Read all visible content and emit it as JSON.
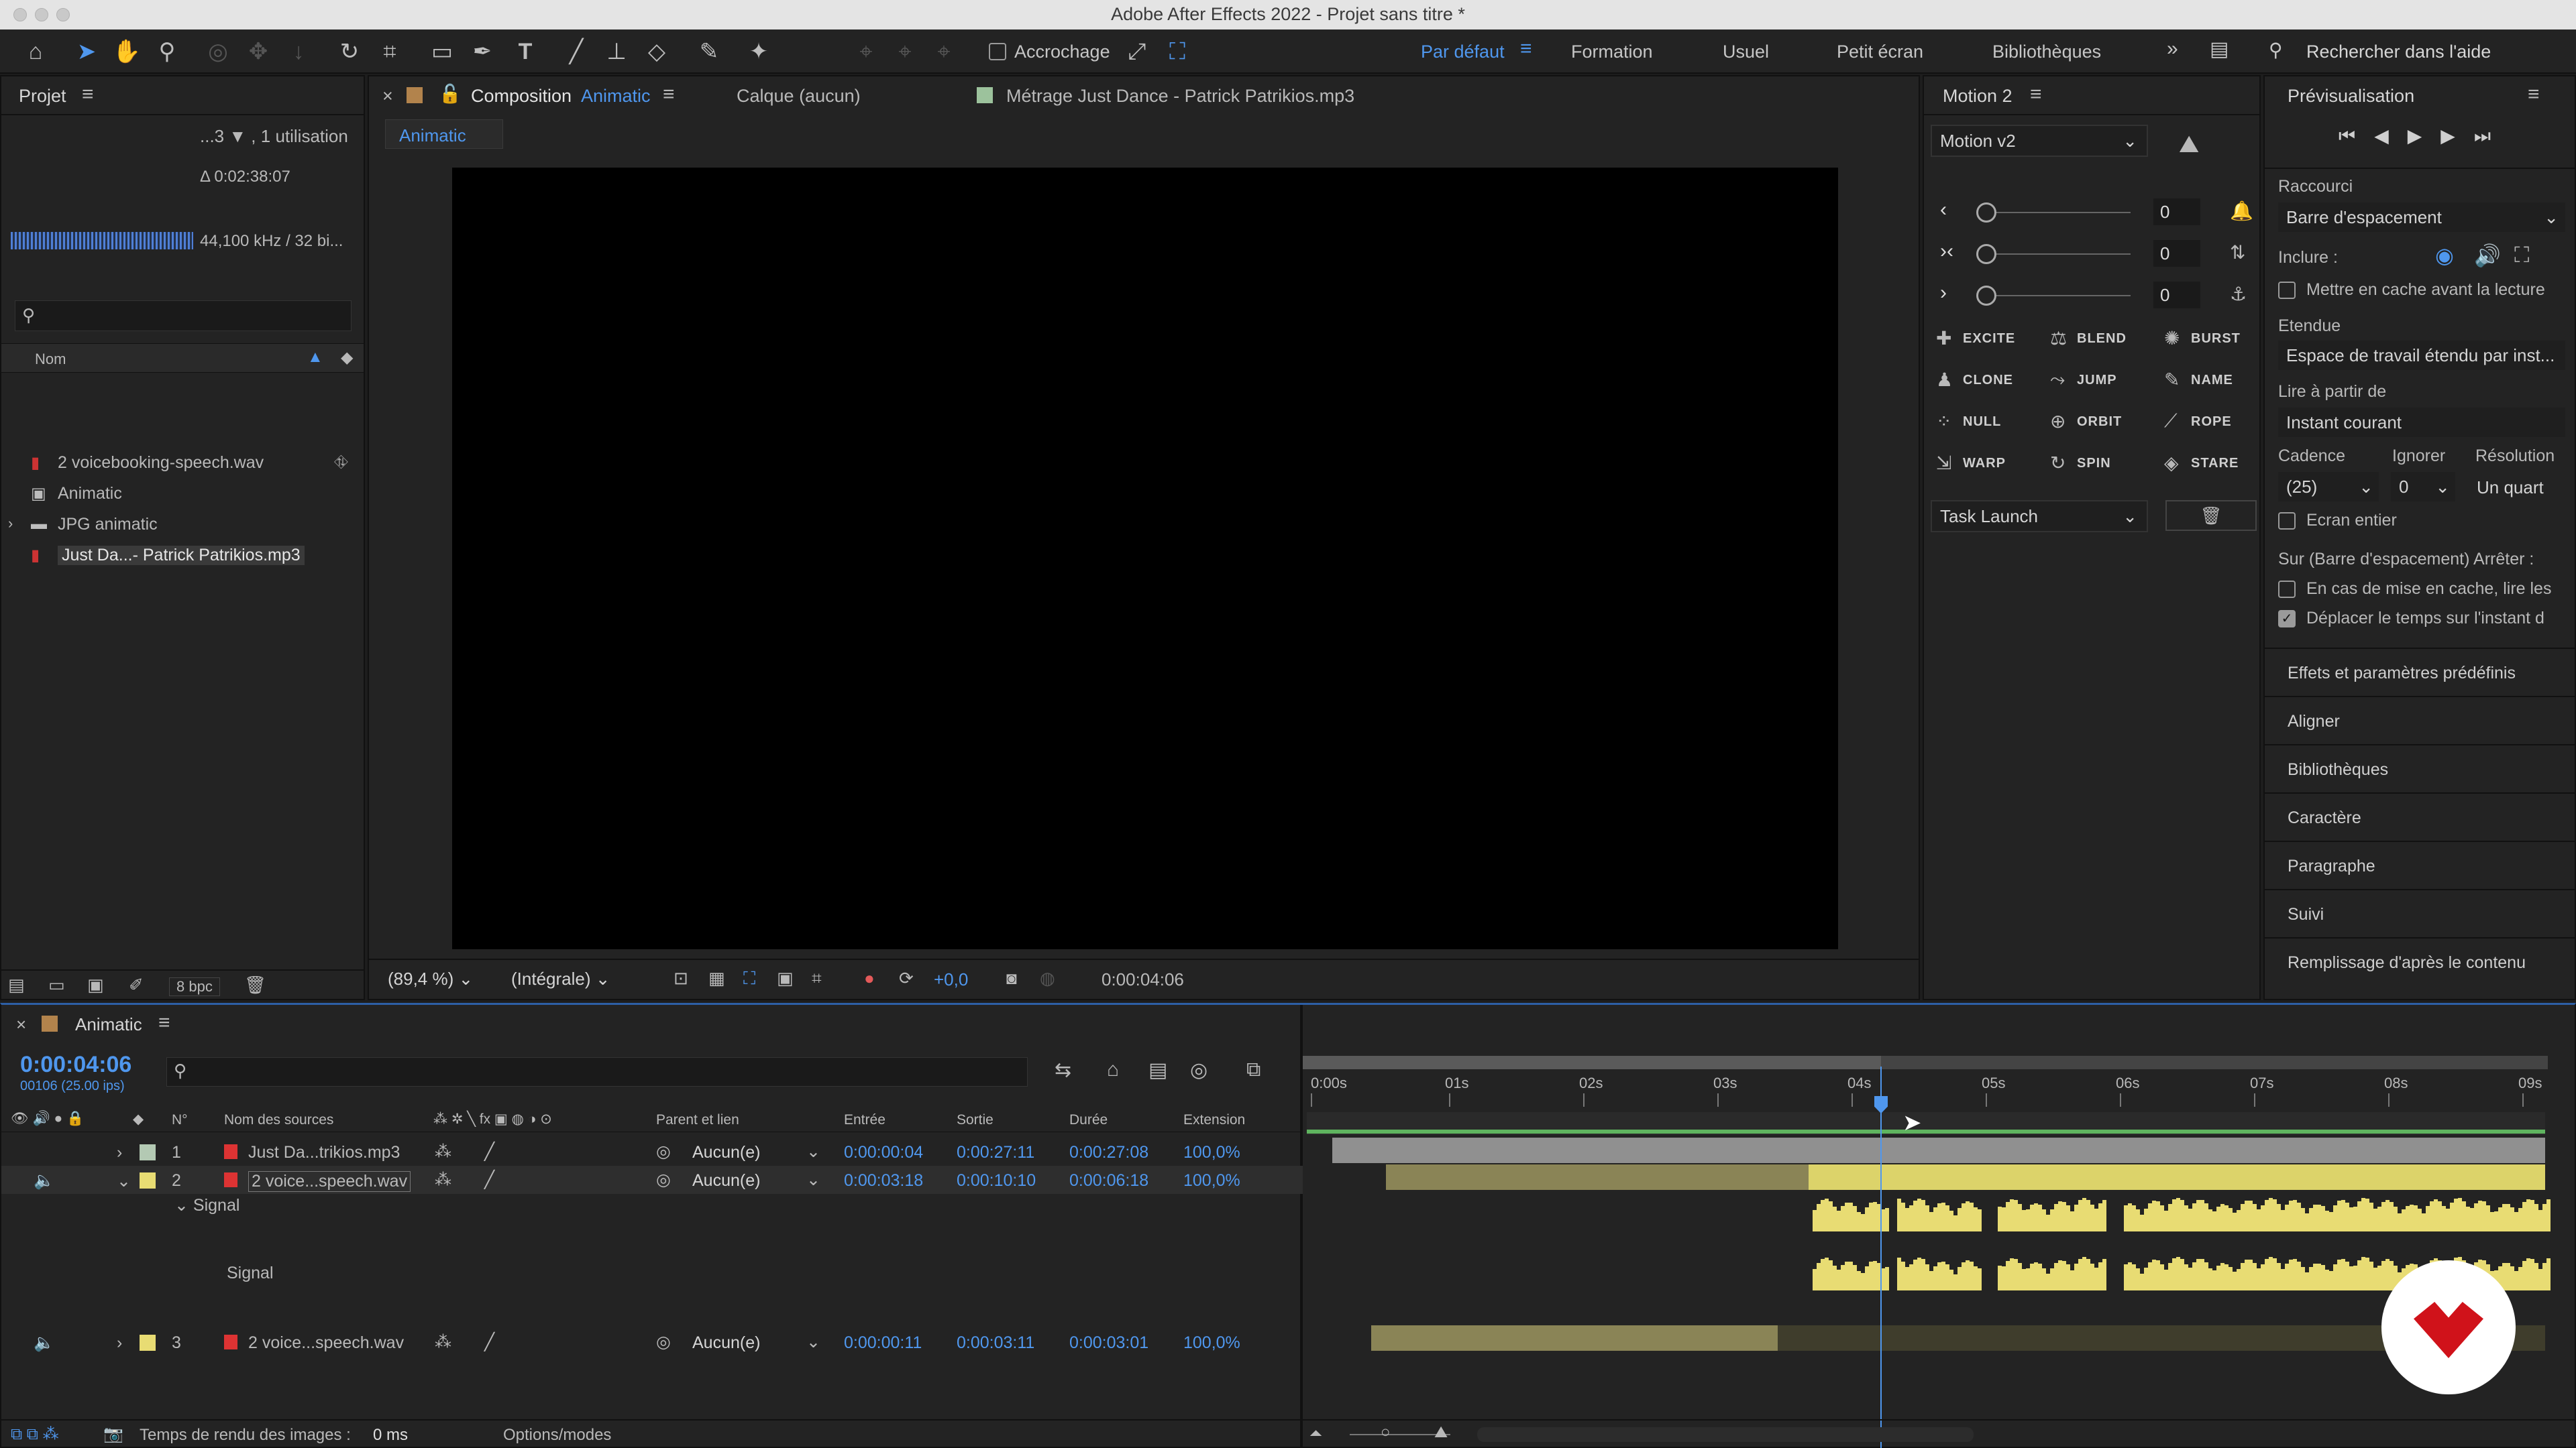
{
  "window": {
    "title": "Adobe After Effects 2022 - Projet sans titre *"
  },
  "toolbar": {
    "snap_label": "Accrochage",
    "workspaces": [
      "Par défaut",
      "Formation",
      "Usuel",
      "Petit écran",
      "Bibliothèques"
    ],
    "search_placeholder": "Rechercher dans l'aide"
  },
  "project": {
    "title": "Projet",
    "usage": "...3 ▼ , 1 utilisation",
    "duration": "Δ 0:02:38:07",
    "audio_info": "44,100 kHz / 32 bi...",
    "col_name": "Nom",
    "items": [
      {
        "name": "2 voicebooking-speech.wav",
        "icon": "audio-file-icon"
      },
      {
        "name": "Animatic",
        "icon": "composition-icon"
      },
      {
        "name": "JPG animatic",
        "icon": "folder-icon"
      },
      {
        "name": "Just Da...- Patrick Patrikios.mp3",
        "icon": "audio-file-icon"
      }
    ],
    "bpc": "8 bpc"
  },
  "composition": {
    "tab_prefix": "Composition",
    "tab_name": "Animatic",
    "layer_label": "Calque  (aucun)",
    "footage_label": "Métrage  Just Dance - Patrick Patrikios.mp3",
    "subtab": "Animatic",
    "zoom": "(89,4 %)",
    "resolution": "(Intégrale)",
    "exposure": "+0,0",
    "timecode": "0:00:04:06"
  },
  "motion": {
    "title": "Motion 2",
    "preset": "Motion v2",
    "sliders": [
      "0",
      "0",
      "0"
    ],
    "buttons": [
      "EXCITE",
      "BLEND",
      "BURST",
      "CLONE",
      "JUMP",
      "NAME",
      "NULL",
      "ORBIT",
      "ROPE",
      "WARP",
      "SPIN",
      "STARE"
    ],
    "task": "Task Launch"
  },
  "preview": {
    "title": "Prévisualisation",
    "shortcut_label": "Raccourci",
    "shortcut_value": "Barre d'espacement",
    "include_label": "Inclure :",
    "cache_label": "Mettre en cache avant la lecture",
    "range_label": "Etendue",
    "range_value": "Espace de travail étendu par inst...",
    "play_from_label": "Lire à partir de",
    "play_from_value": "Instant courant",
    "cadence_label": "Cadence",
    "skip_label": "Ignorer",
    "resolution_label": "Résolution",
    "cadence_value": "(25)",
    "skip_value": "0",
    "resolution_value": "Un quart",
    "fullscreen_label": "Ecran entier",
    "stop_label": "Sur (Barre d'espacement) Arrêter :",
    "cached_label": "En cas de mise en cache, lire les",
    "move_time_label": "Déplacer le temps sur l'instant d",
    "sections": [
      "Effets et paramètres prédéfinis",
      "Aligner",
      "Bibliothèques",
      "Caractère",
      "Paragraphe",
      "Suivi",
      "Remplissage d'après le contenu"
    ]
  },
  "timeline": {
    "tab": "Animatic",
    "timecode": "0:00:04:06",
    "frames": "00106 (25.00 ips)",
    "columns": {
      "num": "N°",
      "source": "Nom des sources",
      "parent": "Parent et lien",
      "in": "Entrée",
      "out": "Sortie",
      "duration": "Durée",
      "stretch": "Extension"
    },
    "ruler": [
      "0:00s",
      "01s",
      "02s",
      "03s",
      "04s",
      "05s",
      "06s",
      "07s",
      "08s",
      "09s"
    ],
    "layers": [
      {
        "num": "1",
        "name": "Just Da...trikios.mp3",
        "parent": "Aucun(e)",
        "in": "0:00:00:04",
        "out": "0:00:27:11",
        "duration": "0:00:27:08",
        "stretch": "100,0%"
      },
      {
        "num": "2",
        "name": "2 voice...speech.wav",
        "parent": "Aucun(e)",
        "in": "0:00:03:18",
        "out": "0:00:10:10",
        "duration": "0:00:06:18",
        "stretch": "100,0%"
      },
      {
        "num": "3",
        "name": "2 voice...speech.wav",
        "parent": "Aucun(e)",
        "in": "0:00:00:11",
        "out": "0:00:03:11",
        "duration": "0:00:03:01",
        "stretch": "100,0%"
      }
    ],
    "signal_group": "Signal",
    "signal_label": "Signal",
    "render_label": "Temps de rendu des images :",
    "render_value": "0 ms",
    "modes_label": "Options/modes"
  }
}
